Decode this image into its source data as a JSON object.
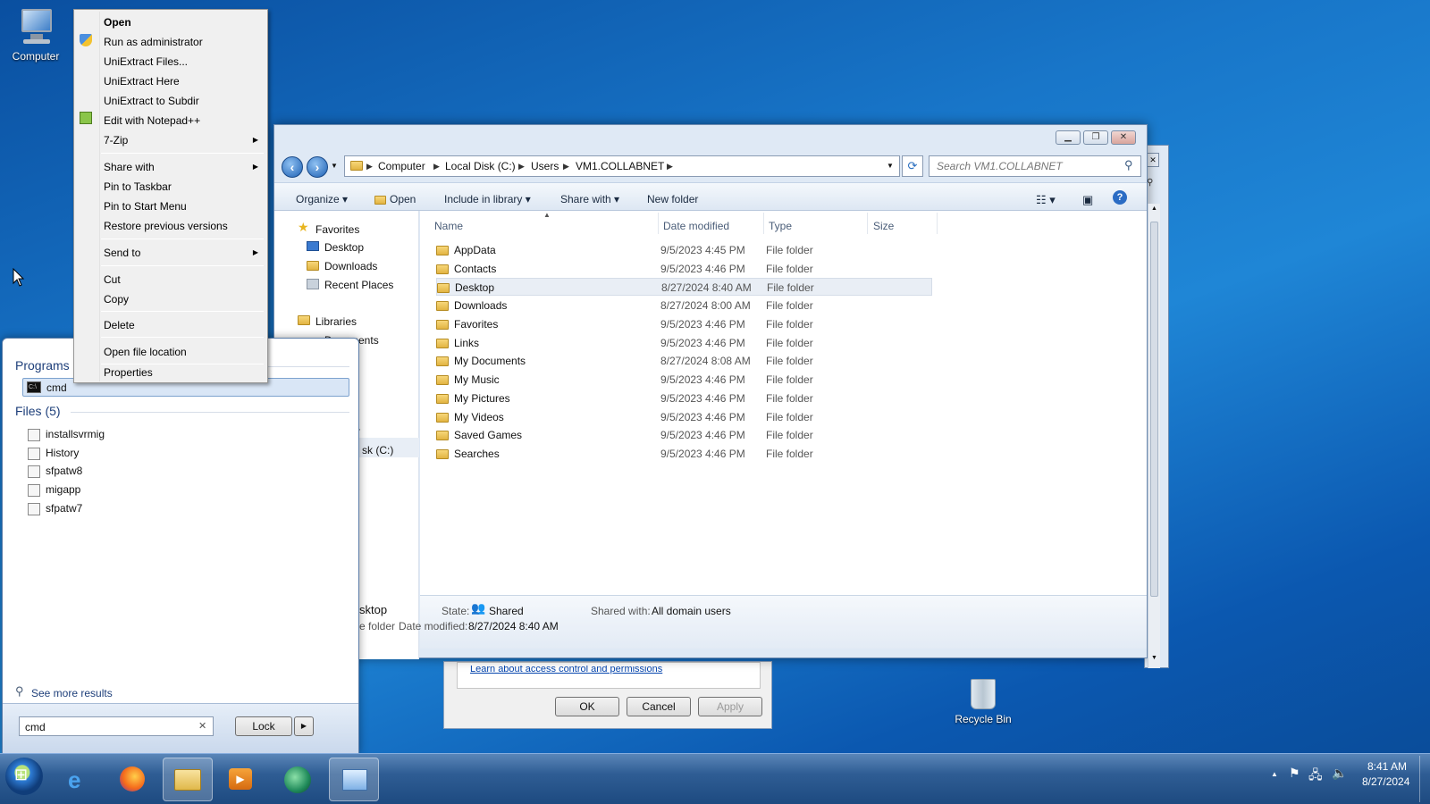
{
  "desktop": {
    "computer_label": "Computer",
    "recycle_label": "Recycle Bin"
  },
  "context_menu": {
    "items": [
      "Open",
      "Run as administrator",
      "UniExtract Files...",
      "UniExtract Here",
      "UniExtract to Subdir",
      "Edit with Notepad++",
      "7-Zip",
      "Share with",
      "Pin to Taskbar",
      "Pin to Start Menu",
      "Restore previous versions",
      "Send to",
      "Cut",
      "Copy",
      "Delete",
      "Open file location",
      "Properties"
    ]
  },
  "explorer": {
    "breadcrumb": [
      "Computer",
      "Local Disk (C:)",
      "Users",
      "VM1.COLLABNET"
    ],
    "search_placeholder": "Search VM1.COLLABNET",
    "toolbar": {
      "organize": "Organize",
      "open": "Open",
      "include": "Include in library",
      "share": "Share with",
      "new_folder": "New folder"
    },
    "nav": {
      "favorites": "Favorites",
      "desktop": "Desktop",
      "downloads": "Downloads",
      "recent": "Recent Places",
      "libraries": "Libraries",
      "documents_partial": "Documents",
      "disk_partial": "sk (C:)",
      "r_partial": "r"
    },
    "columns": {
      "name": "Name",
      "date": "Date modified",
      "type": "Type",
      "size": "Size"
    },
    "rows": [
      {
        "name": "AppData",
        "date": "9/5/2023 4:45 PM",
        "type": "File folder"
      },
      {
        "name": "Contacts",
        "date": "9/5/2023 4:46 PM",
        "type": "File folder"
      },
      {
        "name": "Desktop",
        "date": "8/27/2024 8:40 AM",
        "type": "File folder"
      },
      {
        "name": "Downloads",
        "date": "8/27/2024 8:00 AM",
        "type": "File folder"
      },
      {
        "name": "Favorites",
        "date": "9/5/2023 4:46 PM",
        "type": "File folder"
      },
      {
        "name": "Links",
        "date": "9/5/2023 4:46 PM",
        "type": "File folder"
      },
      {
        "name": "My Documents",
        "date": "8/27/2024 8:08 AM",
        "type": "File folder"
      },
      {
        "name": "My Music",
        "date": "9/5/2023 4:46 PM",
        "type": "File folder"
      },
      {
        "name": "My Pictures",
        "date": "9/5/2023 4:46 PM",
        "type": "File folder"
      },
      {
        "name": "My Videos",
        "date": "9/5/2023 4:46 PM",
        "type": "File folder"
      },
      {
        "name": "Saved Games",
        "date": "9/5/2023 4:46 PM",
        "type": "File folder"
      },
      {
        "name": "Searches",
        "date": "9/5/2023 4:46 PM",
        "type": "File folder"
      }
    ],
    "details": {
      "name_partial": "sktop",
      "type_partial": "e folder",
      "state_label": "State:",
      "state_value": "Shared",
      "shared_label": "Shared with:",
      "shared_value": "All domain users",
      "modified_label": "Date modified:",
      "modified_value": "8/27/2024 8:40 AM"
    }
  },
  "dialog": {
    "link": "Learn about access control and permissions",
    "ok": "OK",
    "cancel": "Cancel",
    "apply": "Apply"
  },
  "start_menu": {
    "programs_header": "Programs",
    "program": "cmd",
    "files_header": "Files (5)",
    "files": [
      "installsvrmig",
      "History",
      "sfpatw8",
      "migapp",
      "sfpatw7"
    ],
    "see_more": "See more results",
    "search_value": "cmd",
    "lock": "Lock"
  },
  "tray": {
    "time": "8:41 AM",
    "date": "8/27/2024"
  }
}
